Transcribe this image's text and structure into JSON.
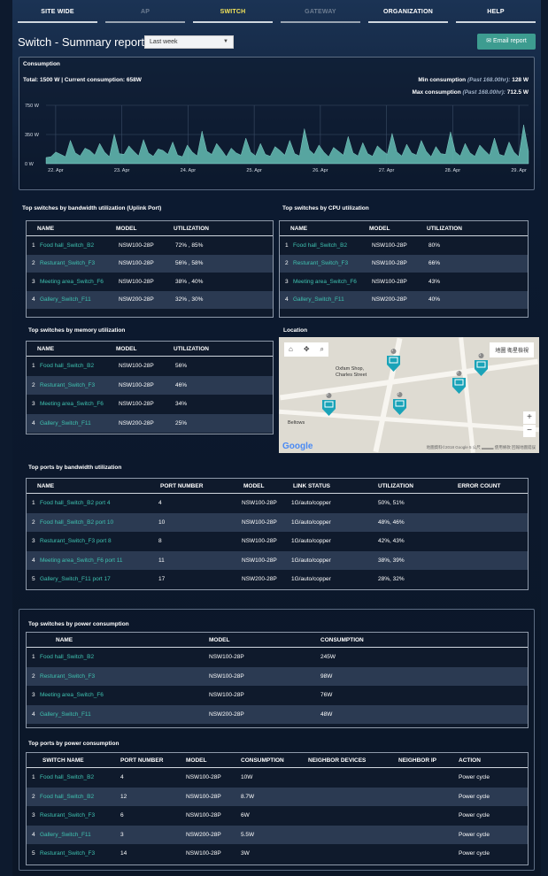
{
  "nav": [
    "SITE WIDE",
    "AP",
    "SWITCH",
    "GATEWAY",
    "ORGANIZATION",
    "HELP"
  ],
  "header": {
    "title": "Switch - Summary report",
    "period": "Last week",
    "email_button": "Email report"
  },
  "consumption": {
    "title": "Consumption",
    "total": "Total: 1500 W | Current consumption: 658W",
    "min_label": "Min consumption",
    "min_period": "(Past 168.00hr):",
    "min_value": "128 W",
    "max_label": "Max consumption",
    "max_period": "(Past 168.00hr):",
    "max_value": "712.5 W"
  },
  "chart_data": {
    "type": "area",
    "yticks": [
      "750 W",
      "350 W",
      "0 W"
    ],
    "ylim": [
      0,
      750
    ],
    "xticks": [
      "22. Apr",
      "23. Apr",
      "24. Apr",
      "25. Apr",
      "26. Apr",
      "27. Apr",
      "28. Apr",
      "29. Apr"
    ],
    "series": [
      {
        "values": [
          80,
          90,
          150,
          120,
          90,
          300,
          140,
          100,
          200,
          170,
          110,
          260,
          150,
          90,
          380,
          130,
          120,
          230,
          160,
          100,
          310,
          140,
          95,
          190,
          170,
          120,
          280,
          110,
          90,
          240,
          150,
          100,
          420,
          160,
          120,
          260,
          180,
          90,
          200,
          140,
          110,
          330,
          150,
          100,
          260,
          120,
          95,
          220,
          170,
          110,
          300,
          130,
          100,
          450,
          180,
          120,
          240,
          150,
          90,
          210,
          160,
          110,
          350,
          140,
          100,
          270,
          130,
          95,
          230,
          170,
          120,
          390,
          150,
          100,
          250,
          140,
          110,
          300,
          160,
          90,
          220,
          130,
          120,
          410,
          150,
          100,
          260,
          140,
          95,
          240,
          170,
          110,
          330,
          120,
          100,
          280,
          150,
          90,
          500,
          160
        ]
      }
    ],
    "color": "#5fb5ad"
  },
  "bandwidth": {
    "title": "Top switches by bandwidth utilization (Uplink Port)",
    "headers": [
      "NAME",
      "MODEL",
      "UTILIZATION"
    ],
    "rows": [
      {
        "n": "1",
        "name": "Food hall_Switch_B2",
        "model": "NSW100-28P",
        "util": "72% , 85%"
      },
      {
        "n": "2",
        "name": "Resturant_Switch_F3",
        "model": "NSW100-28P",
        "util": "56% , 58%"
      },
      {
        "n": "3",
        "name": "Meeting area_Switch_F6",
        "model": "NSW100-28P",
        "util": "38% , 40%"
      },
      {
        "n": "4",
        "name": "Gallery_Switch_F11",
        "model": "NSW200-28P",
        "util": "32% , 30%"
      }
    ]
  },
  "cpu": {
    "title": "Top switches by CPU utilization",
    "headers": [
      "NAME",
      "MODEL",
      "UTILIZATION"
    ],
    "rows": [
      {
        "n": "1",
        "name": "Food hall_Switch_B2",
        "model": "NSW100-28P",
        "util": "80%"
      },
      {
        "n": "2",
        "name": "Resturant_Switch_F3",
        "model": "NSW100-28P",
        "util": "66%"
      },
      {
        "n": "3",
        "name": "Meeting area_Switch_F6",
        "model": "NSW100-28P",
        "util": "43%"
      },
      {
        "n": "4",
        "name": "Gallery_Switch_F11",
        "model": "NSW200-28P",
        "util": "40%"
      }
    ]
  },
  "memory": {
    "title": "Top switches by memory utilization",
    "headers": [
      "NAME",
      "MODEL",
      "UTILIZATION"
    ],
    "rows": [
      {
        "n": "1",
        "name": "Food hall_Switch_B2",
        "model": "NSW100-28P",
        "util": "56%"
      },
      {
        "n": "2",
        "name": "Resturant_Switch_F3",
        "model": "NSW100-28P",
        "util": "46%"
      },
      {
        "n": "3",
        "name": "Meeting area_Switch_F6",
        "model": "NSW100-28P",
        "util": "34%"
      },
      {
        "n": "4",
        "name": "Gallery_Switch_F11",
        "model": "NSW200-28P",
        "util": "25%"
      }
    ]
  },
  "location": {
    "title": "Location",
    "map_type": "地圖    衛星檢視",
    "place1": "Oxfam Shop,",
    "place2": "Charles Street",
    "place3": "Beltows",
    "pins": [
      "1",
      "2",
      "2",
      "1",
      "2"
    ],
    "google": "Google",
    "attribution": "地圖資料©2018 Google  5 公尺 ▂▂▂  使用條款  回報地圖錯誤"
  },
  "ports_bw": {
    "title": "Top ports by bandwidth utilization",
    "headers": [
      "NAME",
      "PORT NUMBER",
      "MODEL",
      "LINK STATUS",
      "UTILIZATION",
      "ERROR COUNT"
    ],
    "rows": [
      {
        "n": "1",
        "name": "Food hall_Switch_B2 port 4",
        "port": "4",
        "model": "NSW100-28P",
        "link": "1G/auto/copper",
        "util": "50%, 51%"
      },
      {
        "n": "2",
        "name": "Food hall_Switch_B2 port 10",
        "port": "10",
        "model": "NSW100-28P",
        "link": "1G/auto/copper",
        "util": "48%, 46%"
      },
      {
        "n": "3",
        "name": "Resturant_Switch_F3 port 8",
        "port": "8",
        "model": "NSW100-28P",
        "link": "1G/auto/copper",
        "util": "42%, 43%"
      },
      {
        "n": "4",
        "name": "Meeting area_Switch_F6 port 11",
        "port": "11",
        "model": "NSW100-28P",
        "link": "1G/auto/copper",
        "util": "38%, 39%"
      },
      {
        "n": "5",
        "name": "Gallery_Switch_F11 port 17",
        "port": "17",
        "model": "NSW200-28P",
        "link": "1G/auto/copper",
        "util": "28%, 32%"
      }
    ]
  },
  "power_switches": {
    "title": "Top switches by power consumption",
    "headers": [
      "NAME",
      "MODEL",
      "CONSUMPTION"
    ],
    "rows": [
      {
        "n": "1",
        "name": "Food hall_Switch_B2",
        "model": "NSW100-28P",
        "cons": "245W"
      },
      {
        "n": "2",
        "name": "Resturant_Switch_F3",
        "model": "NSW100-28P",
        "cons": "98W"
      },
      {
        "n": "3",
        "name": "Meeting area_Switch_F6",
        "model": "NSW100-28P",
        "cons": "76W"
      },
      {
        "n": "4",
        "name": "Gallery_Switch_F11",
        "model": "NSW200-28P",
        "cons": "48W"
      }
    ]
  },
  "power_ports": {
    "title": "Top ports by power consumption",
    "headers": [
      "SWITCH NAME",
      "PORT NUMBER",
      "MODEL",
      "CONSUMPTION",
      "NEIGHBOR DEVICES",
      "NEIGHBOR IP",
      "ACTION"
    ],
    "rows": [
      {
        "n": "1",
        "name": "Food hall_Switch_B2",
        "port": "4",
        "model": "NSW100-28P",
        "cons": "10W",
        "action": "Power cycle"
      },
      {
        "n": "2",
        "name": "Food hall_Switch_B2",
        "port": "12",
        "model": "NSW100-28P",
        "cons": "8.7W",
        "action": "Power cycle"
      },
      {
        "n": "3",
        "name": "Resturant_Switch_F3",
        "port": "6",
        "model": "NSW100-28P",
        "cons": "6W",
        "action": "Power cycle"
      },
      {
        "n": "4",
        "name": "Gallery_Switch_F11",
        "port": "3",
        "model": "NSW200-28P",
        "cons": "5.5W",
        "action": "Power cycle"
      },
      {
        "n": "5",
        "name": "Resturant_Switch_F3",
        "port": "14",
        "model": "NSW100-28P",
        "cons": "3W",
        "action": "Power cycle"
      }
    ]
  }
}
